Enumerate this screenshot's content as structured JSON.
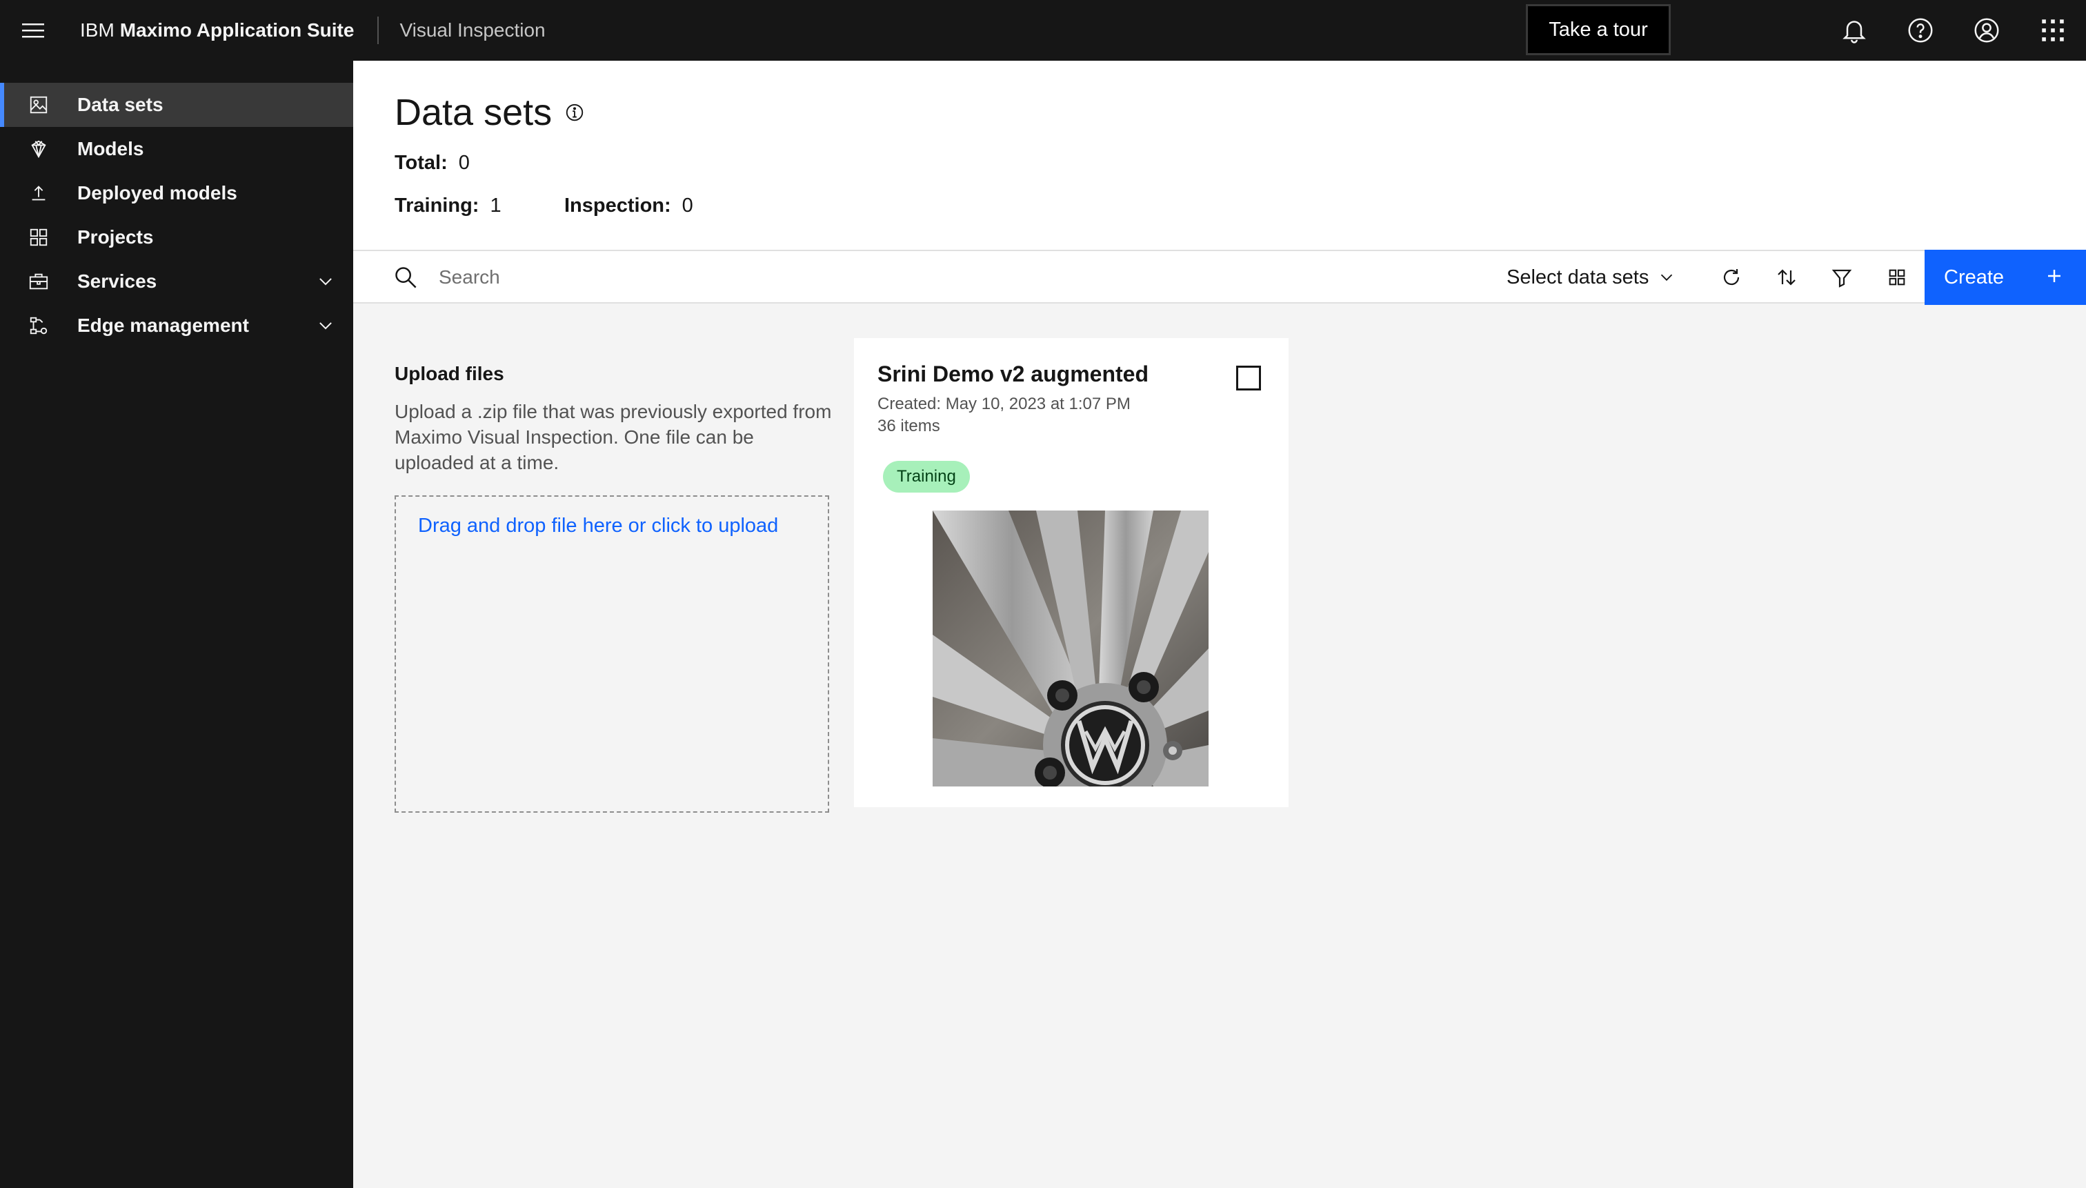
{
  "header": {
    "brand_prefix": "IBM",
    "brand_name": "Maximo Application Suite",
    "product": "Visual Inspection",
    "tour_button": "Take a tour"
  },
  "sidebar": {
    "items": [
      {
        "label": "Data sets",
        "icon": "data-sets-icon",
        "active": true
      },
      {
        "label": "Models",
        "icon": "model-icon"
      },
      {
        "label": "Deployed models",
        "icon": "deploy-icon"
      },
      {
        "label": "Projects",
        "icon": "projects-icon"
      },
      {
        "label": "Services",
        "icon": "services-icon",
        "expandable": true
      },
      {
        "label": "Edge management",
        "icon": "edge-management-icon",
        "expandable": true
      }
    ]
  },
  "page": {
    "title": "Data sets",
    "total_label": "Total:",
    "total_value": "0",
    "training_label": "Training:",
    "training_value": "1",
    "inspection_label": "Inspection:",
    "inspection_value": "0"
  },
  "toolbar": {
    "search_placeholder": "Search",
    "select_label": "Select data sets",
    "create_label": "Create"
  },
  "upload": {
    "title": "Upload files",
    "description": "Upload a .zip file that was previously exported from Maximo Visual Inspection. One file can be uploaded at a time.",
    "dropzone_text": "Drag and drop file here or click to upload"
  },
  "dataset_card": {
    "title": "Srini Demo v2 augmented",
    "created": "Created: May 10, 2023 at 1:07 PM",
    "items": "36 items",
    "tag": "Training"
  },
  "colors": {
    "header_bg": "#161616",
    "accent": "#0f62fe",
    "active_indicator": "#4589ff",
    "training_tag_bg": "#a7f0ba"
  }
}
